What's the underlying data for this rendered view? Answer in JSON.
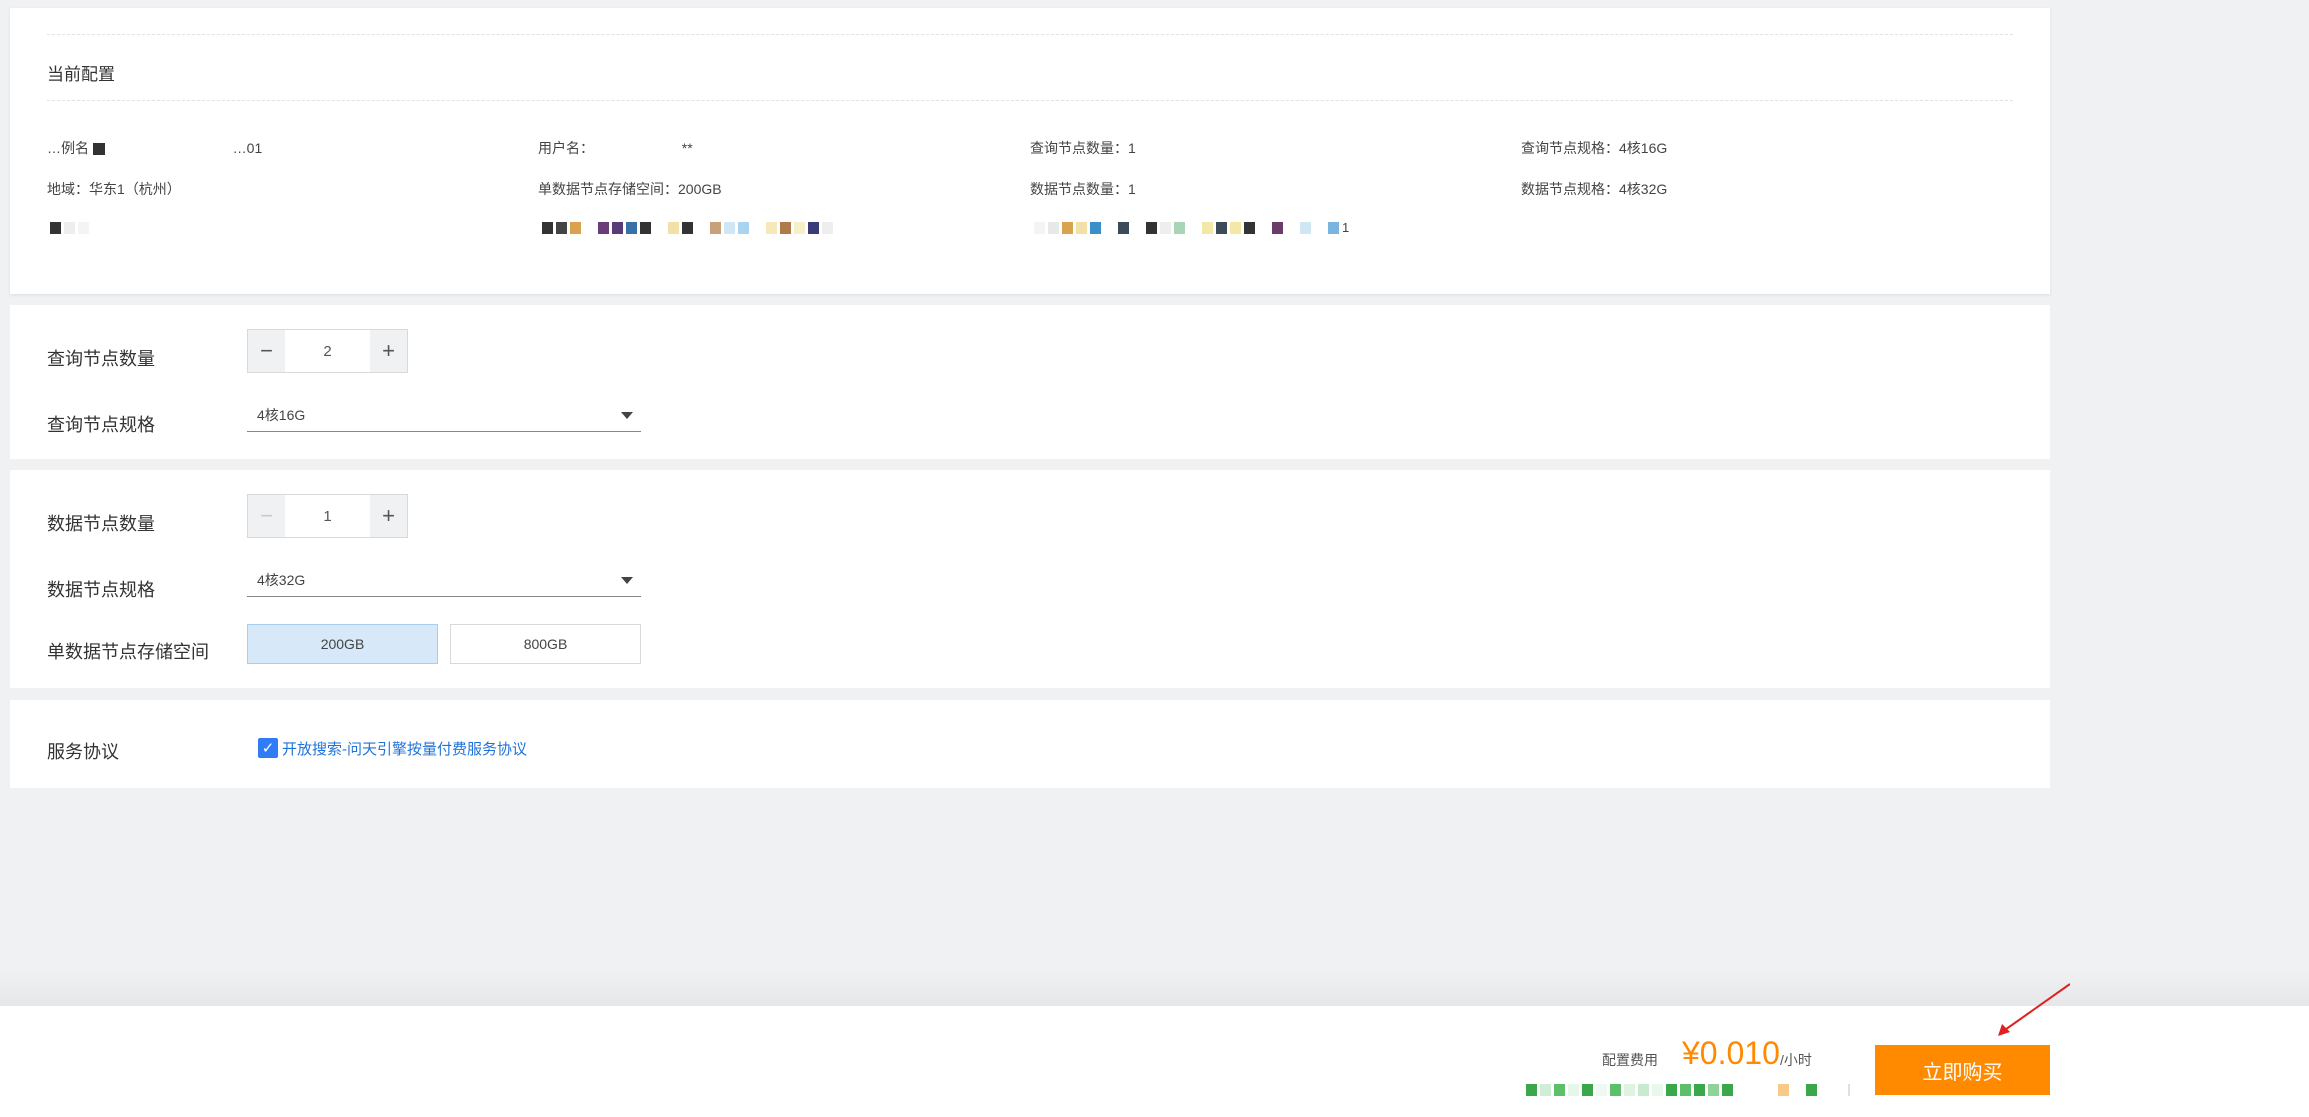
{
  "current_config": {
    "title": "当前配置",
    "col1": [
      {
        "label": "…例名",
        "value": "…01"
      },
      {
        "label": "地域：",
        "value": "华东1（杭州）"
      }
    ],
    "col2": [
      {
        "label": "用户名：",
        "value": "**"
      },
      {
        "label": "单数据节点存储空间：",
        "value": "200GB"
      }
    ],
    "col3": [
      {
        "label": "查询节点数量：",
        "value": "1"
      },
      {
        "label": "数据节点数量：",
        "value": "1"
      }
    ],
    "col4": [
      {
        "label": "查询节点规格：",
        "value": "4核16G"
      },
      {
        "label": "数据节点规格：",
        "value": "4核32G"
      }
    ],
    "col3_blur_suffix": "1"
  },
  "query_node": {
    "count_label": "查询节点数量",
    "count_value": "2",
    "minus": "−",
    "plus": "+",
    "spec_label": "查询节点规格",
    "spec_value": "4核16G"
  },
  "data_node": {
    "count_label": "数据节点数量",
    "count_value": "1",
    "minus": "−",
    "plus": "+",
    "spec_label": "数据节点规格",
    "spec_value": "4核32G",
    "storage_label": "单数据节点存储空间",
    "storage_options": [
      "200GB",
      "800GB"
    ],
    "storage_selected": "200GB"
  },
  "agreement": {
    "label": "服务协议",
    "checked": true,
    "link_text": "开放搜索-问天引擎按量付费服务协议",
    "check_glyph": "✓"
  },
  "footer": {
    "fee_label": "配置费用",
    "price": "¥0.010",
    "unit": "/小时",
    "buy_label": "立即购买"
  },
  "colors": {
    "accent": "#ff8a00",
    "link": "#1f73d8",
    "checkbox": "#2f7cf6",
    "annotation_arrow": "#e02020"
  }
}
